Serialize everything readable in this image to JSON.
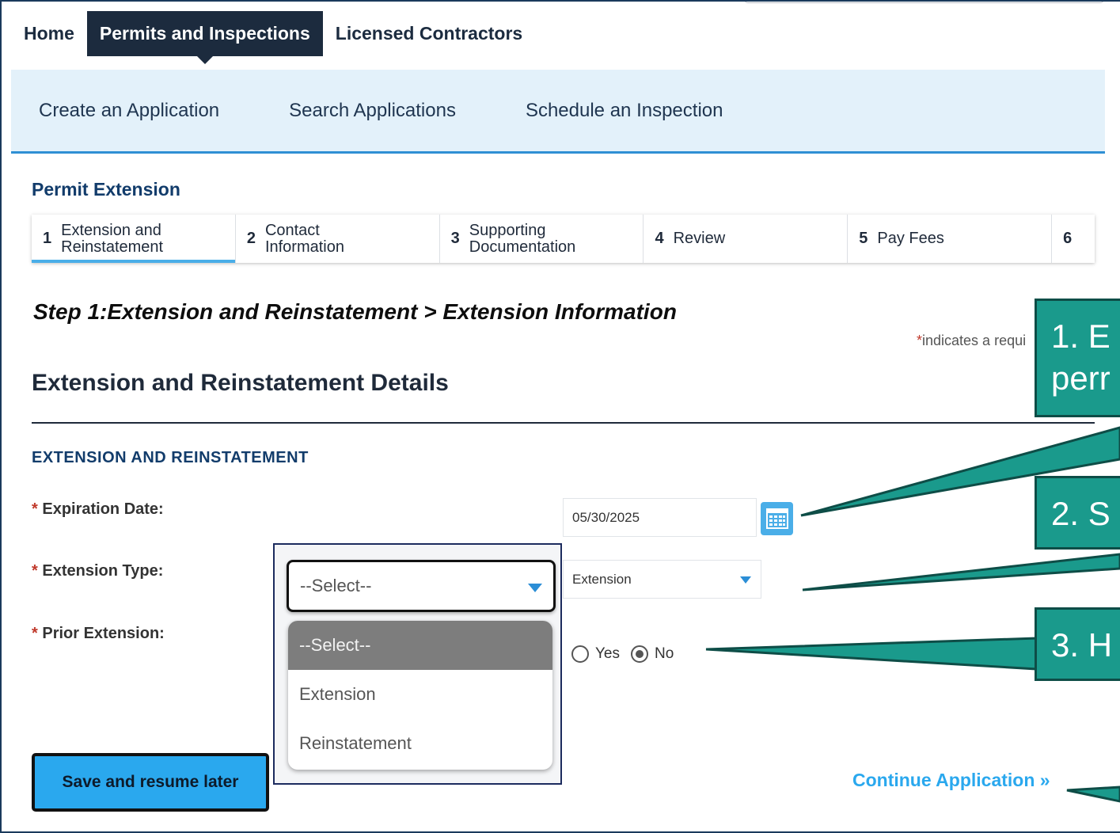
{
  "topnav": {
    "tabs": [
      {
        "label": "Home",
        "active": false
      },
      {
        "label": "Permits and Inspections",
        "active": true
      },
      {
        "label": "Licensed Contractors",
        "active": false
      }
    ]
  },
  "subnav": {
    "items": [
      "Create an Application",
      "Search Applications",
      "Schedule an Inspection"
    ]
  },
  "page": {
    "title": "Permit Extension",
    "breadcrumb": "Step 1:Extension and Reinstatement > Extension Information",
    "required_note": "indicates a requi",
    "section_title": "Extension and Reinstatement Details",
    "subsection_title": "EXTENSION AND REINSTATEMENT"
  },
  "steps": [
    {
      "num": "1",
      "label_line1": "Extension and",
      "label_line2": "Reinstatement",
      "active": true
    },
    {
      "num": "2",
      "label_line1": "Contact",
      "label_line2": "Information",
      "active": false
    },
    {
      "num": "3",
      "label_line1": "Supporting",
      "label_line2": "Documentation",
      "active": false
    },
    {
      "num": "4",
      "label_line1": "Review",
      "label_line2": "",
      "active": false
    },
    {
      "num": "5",
      "label_line1": "Pay Fees",
      "label_line2": "",
      "active": false
    },
    {
      "num": "6",
      "label_line1": "",
      "label_line2": "",
      "active": false
    }
  ],
  "form": {
    "expiration_date": {
      "label": "Expiration Date:",
      "value": "05/30/2025"
    },
    "extension_type": {
      "label": "Extension Type:",
      "value": "Extension"
    },
    "prior_extension": {
      "label": "Prior Extension:",
      "options": [
        "Yes",
        "No"
      ],
      "selected": "No"
    }
  },
  "dropdown_callout": {
    "selected": "--Select--",
    "options": [
      "--Select--",
      "Extension",
      "Reinstatement"
    ]
  },
  "actions": {
    "save_label": "Save and resume later",
    "continue_label": "Continue Application »"
  },
  "callouts": [
    {
      "line1": "1. E",
      "line2": "perr"
    },
    {
      "line1": "2. S",
      "line2": ""
    },
    {
      "line1": "3. H",
      "line2": ""
    }
  ],
  "colors": {
    "nav_active_bg": "#1c2b3e",
    "subnav_bg": "#e3f1fa",
    "accent_blue": "#2aa8ee",
    "title_blue": "#123c6b",
    "callout_teal": "#1a9a8c",
    "required_red": "#c0392b"
  }
}
